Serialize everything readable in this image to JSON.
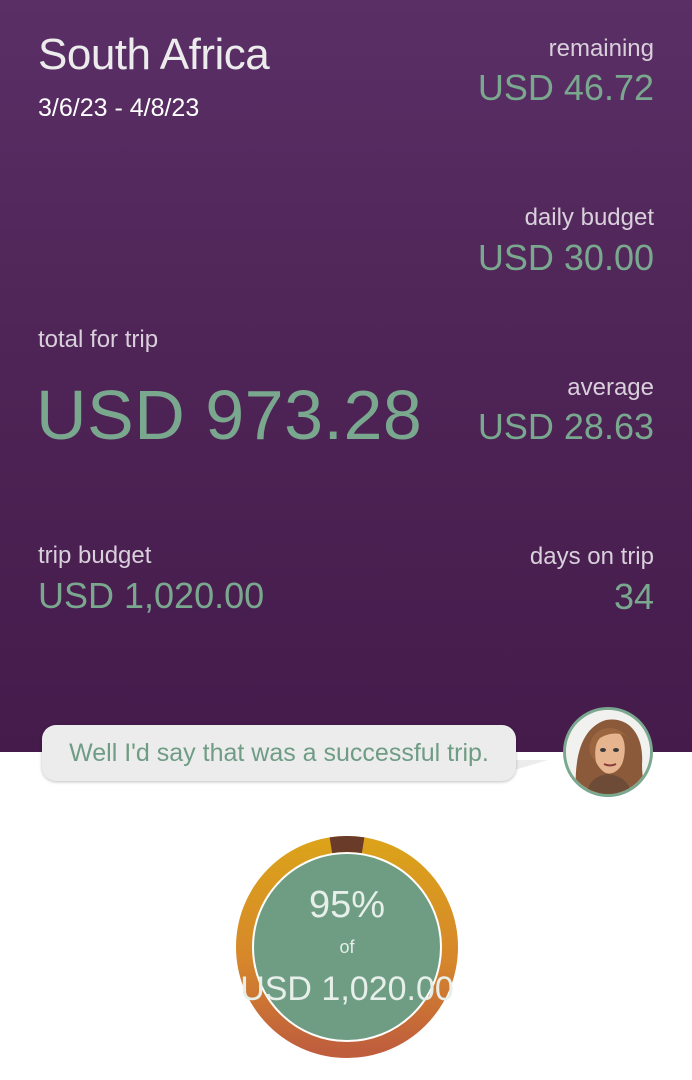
{
  "trip": {
    "name": "South Africa",
    "dates": "3/6/23 - 4/8/23"
  },
  "stats": {
    "remaining": {
      "label": "remaining",
      "value": "USD 46.72"
    },
    "daily_budget": {
      "label": "daily budget",
      "value": "USD 30.00"
    },
    "total": {
      "label": "total for trip",
      "value": "USD 973.28"
    },
    "average": {
      "label": "average",
      "value": "USD 28.63"
    },
    "trip_budget": {
      "label": "trip budget",
      "value": "USD 1,020.00"
    },
    "days": {
      "label": "days on trip",
      "value": "34"
    }
  },
  "message": {
    "text": "Well I'd say that was a successful trip.",
    "avatar": "woman-avatar-icon"
  },
  "gauge": {
    "percent_text": "95%",
    "of_text": "of",
    "amount_text": "USD 1,020.00",
    "fraction_used": 0.95
  },
  "colors": {
    "header_bg": "#4f2557",
    "accent_green": "#7aa88f",
    "gauge_inner": "#6e9d84",
    "ring_start": "#d9a21b",
    "ring_end": "#c0603c",
    "ring_gap": "#6b3b2a"
  }
}
